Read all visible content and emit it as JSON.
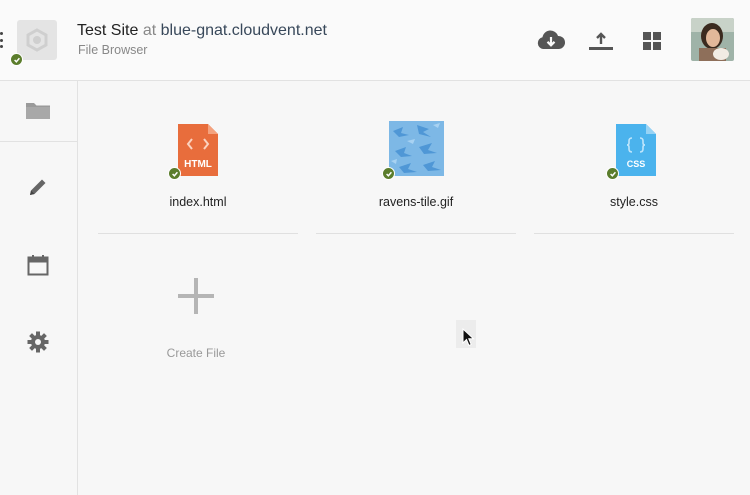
{
  "header": {
    "site_name": "Test Site",
    "at_label": "at",
    "domain": "blue-gnat.cloudvent.net",
    "subtitle": "File Browser",
    "icons": [
      "cloud-download-icon",
      "upload-icon",
      "grid-view-icon"
    ],
    "status": "published"
  },
  "sidebar": {
    "items": [
      {
        "name": "folder-icon"
      },
      {
        "name": "pencil-icon"
      },
      {
        "name": "calendar-icon"
      },
      {
        "name": "gear-icon"
      }
    ]
  },
  "files": [
    {
      "name": "index.html",
      "badge": "HTML",
      "type": "html",
      "color": "#e86d3c"
    },
    {
      "name": "ravens-tile.gif",
      "type": "gif",
      "color": "#7db8e6"
    },
    {
      "name": "style.css",
      "badge": "CSS",
      "type": "css",
      "color": "#4bb3ed"
    }
  ],
  "create": {
    "label": "Create File"
  },
  "colors": {
    "check": "#5b7d2c",
    "html": "#e86d3c",
    "css": "#4bb3ed"
  }
}
